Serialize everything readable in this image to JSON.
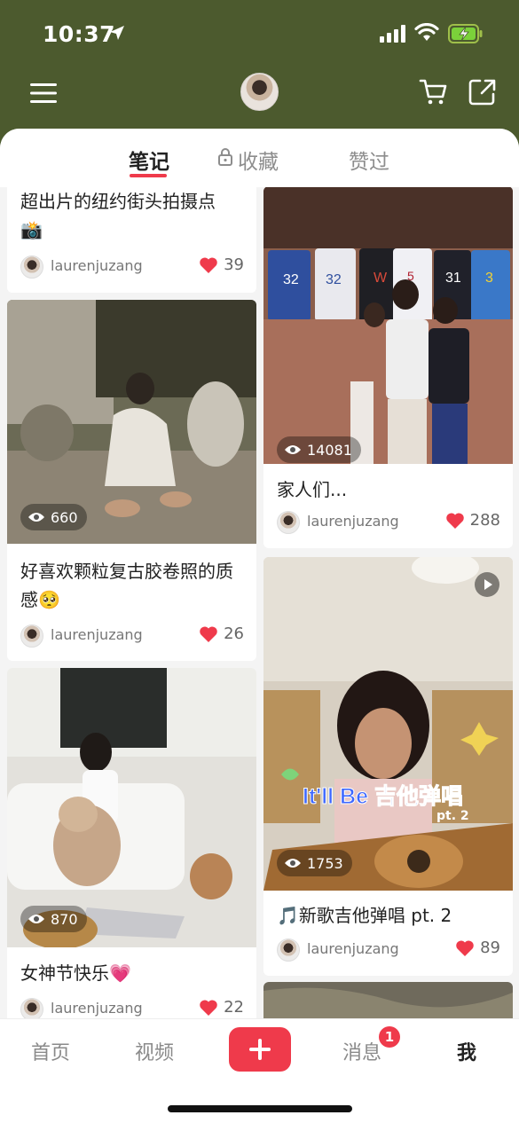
{
  "status": {
    "time": "10:37"
  },
  "tabs": [
    "笔记",
    "收藏",
    "赞过"
  ],
  "cards": [
    {
      "title": "超出片的纽约街头拍摄点",
      "emoji": "📸",
      "user": "laurenjuzang",
      "likes": "39"
    },
    {
      "views": "14081",
      "title": "家人们...",
      "user": "laurenjuzang",
      "likes": "288"
    },
    {
      "views": "660",
      "title": "好喜欢颗粒复古胶卷照的质感🥺",
      "user": "laurenjuzang",
      "likes": "26"
    },
    {
      "views": "1753",
      "title": "🎵新歌吉他弹唱 pt. 2",
      "user": "laurenjuzang",
      "likes": "89",
      "overlay_text": "It'll Be 吉他弹唱",
      "overlay_sub": "pt. 2"
    },
    {
      "views": "870",
      "title": "女神节快乐💗",
      "user": "laurenjuzang",
      "likes": "22"
    }
  ],
  "nav": {
    "home": "首页",
    "video": "视频",
    "messages": "消息",
    "badge": "1",
    "me": "我"
  },
  "colors": {
    "header_bg": "#4c5a2e",
    "accent": "#ef3a4b"
  }
}
